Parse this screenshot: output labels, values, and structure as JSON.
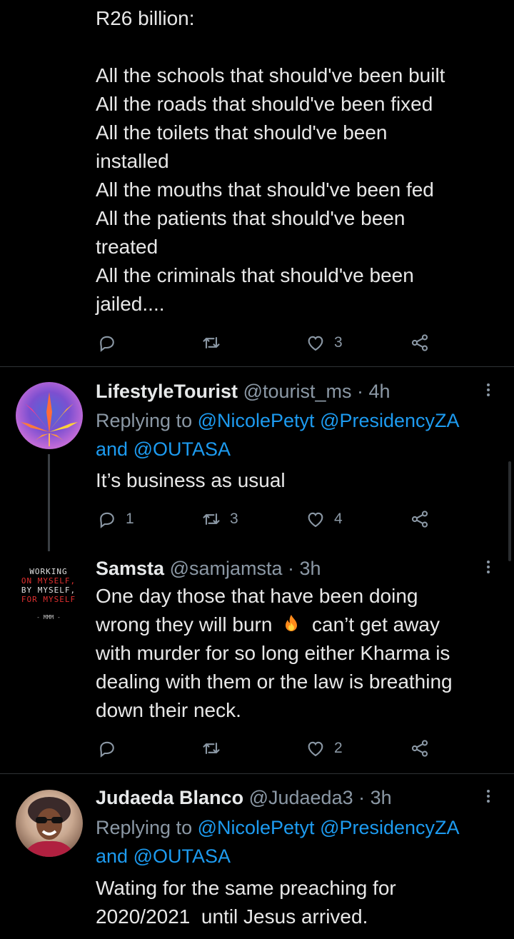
{
  "tweet1": {
    "lines": [
      "R26 billion:",
      "",
      "All the schools that should've been built",
      "All the roads that should've been fixed",
      "All the toilets that should've been",
      "installed",
      "All the mouths that should've been fed",
      "All the patients that should've been",
      "treated",
      "All the criminals that should've been",
      "jailed...."
    ],
    "actions": {
      "reply_count": "",
      "retweet_count": "",
      "like_count": "3"
    }
  },
  "tweet2": {
    "name": "LifestyleTourist",
    "handle": "@tourist_ms",
    "time": "· 4h",
    "replying_prefix": "Replying to ",
    "mention1": "@NicolePetyt",
    "mention2": "@PresidencyZA",
    "and_word": "and ",
    "mention3": "@OUTASA",
    "text": "It’s business as usual",
    "actions": {
      "reply_count": "1",
      "retweet_count": "3",
      "like_count": "4"
    }
  },
  "tweet3": {
    "name": "Samsta",
    "handle": "@samjamsta",
    "time": "· 3h",
    "avatar_lines": [
      "WORKING",
      "ON MYSELF,",
      "BY MYSELF,",
      "FOR MYSELF",
      "- MMM -"
    ],
    "lines": [
      "One day those that have been doing",
      "wrong they will burn",
      "can’t get away",
      "with murder for so long either Kharma is",
      "dealing with them or the law is breathing",
      "down their neck."
    ],
    "actions": {
      "reply_count": "",
      "retweet_count": "",
      "like_count": "2"
    }
  },
  "tweet4": {
    "name": "Judaeda Blanco",
    "handle": "@Judaeda3",
    "time": "· 3h",
    "replying_prefix": "Replying to ",
    "mention1": "@NicolePetyt",
    "mention2": "@PresidencyZA",
    "and_word": "and ",
    "mention3": "@OUTASA",
    "lines": [
      "Wating for the same preaching for",
      "2020/2021  until Jesus arrived."
    ]
  },
  "icons": {
    "reply": "reply-icon",
    "retweet": "retweet-icon",
    "like": "heart-icon",
    "share": "share-icon",
    "more": "more-icon",
    "fire": "fire-icon"
  },
  "colors": {
    "background": "#000000",
    "text": "#e7e9ea",
    "secondary": "#8b98a5",
    "link": "#1d9bf0",
    "divider": "#2f3336"
  }
}
